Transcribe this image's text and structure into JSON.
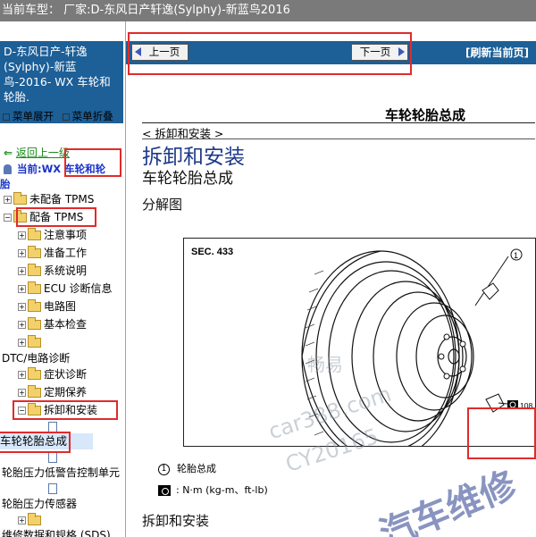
{
  "topbar": {
    "text": "当前车型： 厂家:D-东风日产轩逸(Sylphy)-新蓝鸟2016"
  },
  "left_panel": {
    "header_lines": [
      "D-东风日产-轩逸",
      "(Sylphy)-新蓝",
      "鸟-2016- WX 车轮和",
      "轮胎."
    ],
    "menu_expand": "菜单展开",
    "menu_collapse": "菜单折叠",
    "back_link": "返回上一级",
    "current_label": "当前:",
    "current_value": "WX 车轮和轮",
    "current_cont": "胎",
    "tree": [
      {
        "label": "未配备 TPMS"
      },
      {
        "label": "配备 TPMS"
      },
      {
        "label": "注意事项"
      },
      {
        "label": "准备工作"
      },
      {
        "label": "系统说明"
      },
      {
        "label": "ECU 诊断信息"
      },
      {
        "label": "电路图"
      },
      {
        "label": "基本检查"
      },
      {
        "label": ""
      },
      {
        "label": "DTC/电路诊断"
      },
      {
        "label": "症状诊断"
      },
      {
        "label": "定期保养"
      },
      {
        "label": "拆卸和安装"
      },
      {
        "label": "车轮轮胎总成"
      },
      {
        "label": "轮胎压力低警告控制单元"
      },
      {
        "label": "轮胎压力传感器"
      },
      {
        "label": "维修数据和规格 (SDS)"
      }
    ]
  },
  "navbar": {
    "prev": "上一页",
    "next": "下一页",
    "refresh": "[刷新当前页]"
  },
  "content": {
    "doc_title": "车轮轮胎总成",
    "section_tag": "< 拆卸和安装 >",
    "heading_big": "拆卸和安装",
    "heading_mid": "车轮轮胎总成",
    "heading_small": "分解图",
    "figure_sec": "SEC. 433",
    "callout_1": "1",
    "torque_value": "108",
    "legend_item1": "轮胎总成",
    "legend_num1": "1",
    "legend_item2": ": N·m (kg-m、ft-lb)",
    "heading_foot": "拆卸和安装"
  },
  "watermark": {
    "line1": "畅易",
    "line2": "car388.com",
    "line3": "CY20165",
    "line4": "汽车维修"
  },
  "colors": {
    "header_bg": "#1d5f97",
    "highlight_red": "#e12b2b",
    "heading_blue": "#1d3a8a"
  }
}
